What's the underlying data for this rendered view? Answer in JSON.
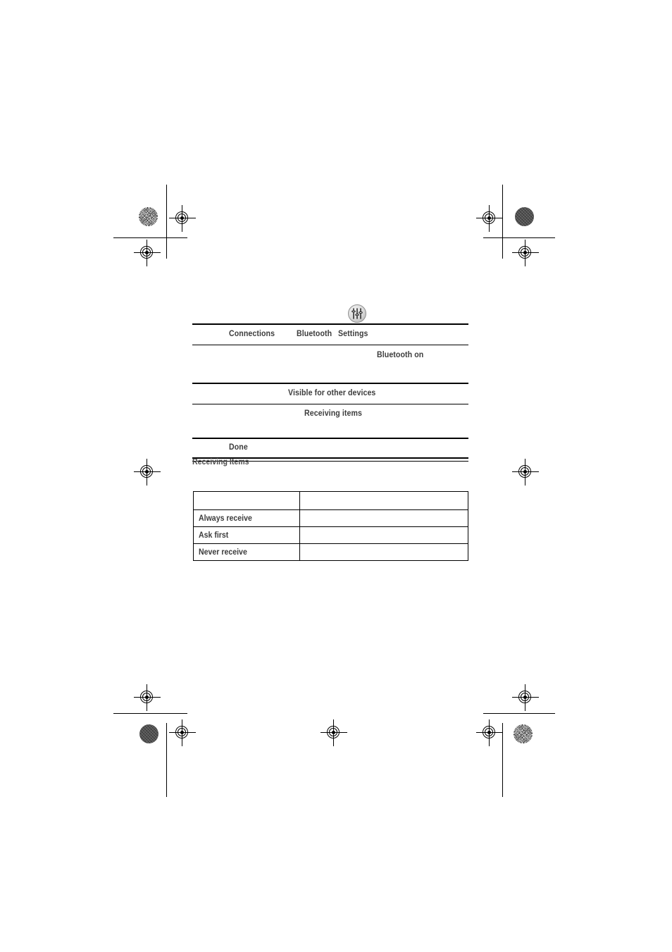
{
  "page": {
    "type": "printed-manual-page-scan",
    "background_color": "#ffffff",
    "text_color": "#3c3c3c",
    "rule_color": "#000000"
  },
  "nav_table": {
    "icon": "sliders-settings-icon",
    "rows": [
      {
        "cells": [
          {
            "text": "Connections",
            "align": "left-indent"
          },
          {
            "text": "Bluetooth",
            "align": "mid"
          },
          {
            "text": "Settings",
            "align": "mid2"
          }
        ]
      },
      {
        "cells": [
          {
            "text": "Bluetooth on",
            "align": "right"
          }
        ]
      },
      {
        "cells": [
          {
            "text": "Visible for other devices",
            "align": "center"
          }
        ]
      },
      {
        "cells": [
          {
            "text": "Receiving items",
            "align": "center"
          }
        ]
      },
      {
        "cells": [
          {
            "text": "Done",
            "align": "left-indent"
          }
        ]
      }
    ]
  },
  "section": {
    "heading": "Receiving Items"
  },
  "ref_table": {
    "header": {
      "left": "",
      "right": ""
    },
    "rows": [
      {
        "label": "Always receive",
        "value": ""
      },
      {
        "label": "Ask first",
        "value": ""
      },
      {
        "label": "Never receive",
        "value": ""
      }
    ]
  }
}
